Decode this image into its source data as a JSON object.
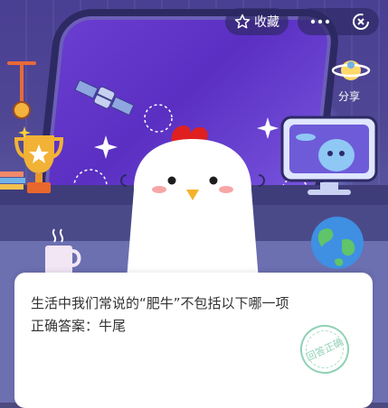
{
  "topbar": {
    "favorite_label": "收藏",
    "more_icon": "more-dots-icon",
    "close_icon": "close-circle-icon"
  },
  "share": {
    "label": "分享",
    "icon": "planet-share-icon"
  },
  "quiz": {
    "question": "生活中我们常说的“肥牛”不包括以下哪一项",
    "answer_prefix": "正确答案：",
    "answer": "牛尾",
    "stamp_text": "回答正确"
  },
  "colors": {
    "background": "#4f4794",
    "window": "#6a3ed0",
    "card": "#ffffff",
    "stamp": "#7dc9a9",
    "chicken_comb": "#e02020"
  }
}
